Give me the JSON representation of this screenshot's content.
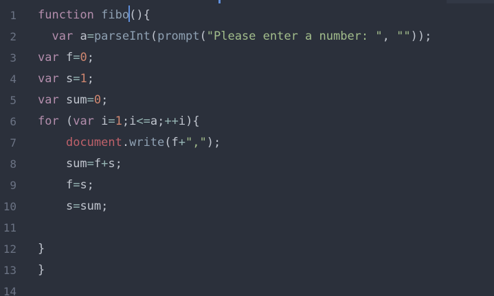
{
  "editor": {
    "line_numbers": [
      "1",
      "2",
      "3",
      "4",
      "5",
      "6",
      "7",
      "8",
      "9",
      "10",
      "11",
      "12",
      "13",
      "14"
    ],
    "lines": [
      {
        "tokens": [
          [
            "kw",
            "function"
          ],
          [
            "plain",
            " "
          ],
          [
            "fn",
            "fibo"
          ],
          [
            "cursor",
            ""
          ],
          [
            "plain",
            "(){"
          ]
        ]
      },
      {
        "tokens": [
          [
            "plain",
            "  "
          ],
          [
            "kw",
            "var"
          ],
          [
            "plain",
            " a"
          ],
          [
            "op",
            "="
          ],
          [
            "fn",
            "parseInt"
          ],
          [
            "plain",
            "("
          ],
          [
            "fn",
            "prompt"
          ],
          [
            "plain",
            "("
          ],
          [
            "str",
            "\"Please enter a number: \""
          ],
          [
            "plain",
            ", "
          ],
          [
            "str",
            "\"\""
          ],
          [
            "plain",
            "));"
          ]
        ]
      },
      {
        "tokens": [
          [
            "kw",
            "var"
          ],
          [
            "plain",
            " f"
          ],
          [
            "op",
            "="
          ],
          [
            "num",
            "0"
          ],
          [
            "plain",
            ";"
          ]
        ]
      },
      {
        "tokens": [
          [
            "kw",
            "var"
          ],
          [
            "plain",
            " s"
          ],
          [
            "op",
            "="
          ],
          [
            "num",
            "1"
          ],
          [
            "plain",
            ";"
          ]
        ]
      },
      {
        "tokens": [
          [
            "kw",
            "var"
          ],
          [
            "plain",
            " sum"
          ],
          [
            "op",
            "="
          ],
          [
            "num",
            "0"
          ],
          [
            "plain",
            ";"
          ]
        ]
      },
      {
        "tokens": [
          [
            "kw",
            "for"
          ],
          [
            "plain",
            " ("
          ],
          [
            "kw",
            "var"
          ],
          [
            "plain",
            " i"
          ],
          [
            "op",
            "="
          ],
          [
            "num",
            "1"
          ],
          [
            "plain",
            ";i"
          ],
          [
            "op",
            "<="
          ],
          [
            "plain",
            "a;"
          ],
          [
            "op",
            "++"
          ],
          [
            "plain",
            "i){"
          ]
        ]
      },
      {
        "tokens": [
          [
            "plain",
            "    "
          ],
          [
            "obj",
            "document"
          ],
          [
            "plain",
            "."
          ],
          [
            "fn",
            "write"
          ],
          [
            "plain",
            "(f"
          ],
          [
            "op",
            "+"
          ],
          [
            "str",
            "\",\""
          ],
          [
            "plain",
            ");"
          ]
        ]
      },
      {
        "tokens": [
          [
            "plain",
            "    sum"
          ],
          [
            "op",
            "="
          ],
          [
            "plain",
            "f"
          ],
          [
            "op",
            "+"
          ],
          [
            "plain",
            "s;"
          ]
        ]
      },
      {
        "tokens": [
          [
            "plain",
            "    f"
          ],
          [
            "op",
            "="
          ],
          [
            "plain",
            "s;"
          ]
        ]
      },
      {
        "tokens": [
          [
            "plain",
            "    s"
          ],
          [
            "op",
            "="
          ],
          [
            "plain",
            "sum;"
          ]
        ]
      },
      {
        "tokens": []
      },
      {
        "tokens": [
          [
            "plain",
            "}"
          ]
        ]
      },
      {
        "tokens": [
          [
            "plain",
            "}"
          ]
        ]
      },
      {
        "tokens": []
      }
    ]
  }
}
